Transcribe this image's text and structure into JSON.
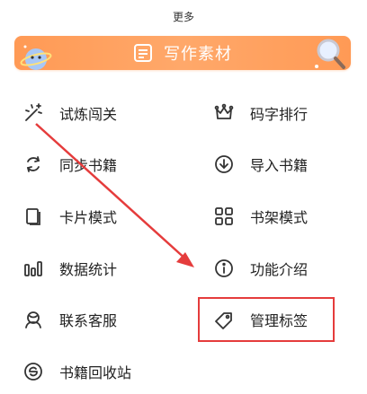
{
  "header": {
    "title": "更多"
  },
  "banner": {
    "label": "写作素材"
  },
  "menu": {
    "left": [
      {
        "label": "试炼闯关",
        "icon": "sparkle-wand-icon"
      },
      {
        "label": "同步书籍",
        "icon": "sync-icon"
      },
      {
        "label": "卡片模式",
        "icon": "card-icon"
      },
      {
        "label": "数据统计",
        "icon": "bar-chart-icon"
      },
      {
        "label": "联系客服",
        "icon": "headset-icon"
      },
      {
        "label": "书籍回收站",
        "icon": "recycle-icon"
      }
    ],
    "right": [
      {
        "label": "码字排行",
        "icon": "crown-icon"
      },
      {
        "label": "导入书籍",
        "icon": "import-icon"
      },
      {
        "label": "书架模式",
        "icon": "grid-icon"
      },
      {
        "label": "功能介绍",
        "icon": "info-icon"
      },
      {
        "label": "管理标签",
        "icon": "tag-icon"
      }
    ]
  },
  "colors": {
    "banner": "#ff9a55",
    "highlight": "#e53c3c",
    "icon": "#333333"
  }
}
